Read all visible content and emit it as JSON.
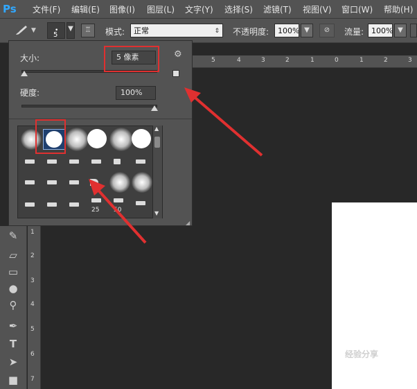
{
  "menubar": {
    "logo": "Ps",
    "items": [
      "文件(F)",
      "编辑(E)",
      "图像(I)",
      "图层(L)",
      "文字(Y)",
      "选择(S)",
      "滤镜(T)",
      "视图(V)",
      "窗口(W)",
      "帮助(H)"
    ]
  },
  "options_bar": {
    "brush_size_value": "5",
    "mode_label": "模式:",
    "mode_value": "正常",
    "opacity_label": "不透明度:",
    "opacity_value": "100%",
    "flow_label": "流量:",
    "flow_value": "100%"
  },
  "brush_panel": {
    "size_label": "大小:",
    "size_value": "5 像素",
    "hardness_label": "硬度:",
    "hardness_value": "100%",
    "size_slider_fraction": 0.0,
    "hardness_slider_fraction": 1.0,
    "preset_numbers": [
      "25",
      "50"
    ]
  },
  "ruler_top_ticks": [
    "5",
    "4",
    "3",
    "2",
    "1",
    "0",
    "1",
    "2",
    "3"
  ],
  "ruler_left_ticks": [
    "1",
    "2",
    "3",
    "4",
    "5",
    "6",
    "7"
  ],
  "watermark": "经验分享",
  "colors": {
    "highlight": "#e03030",
    "arrow": "#e03030",
    "ps_logo": "#31a8ff"
  }
}
